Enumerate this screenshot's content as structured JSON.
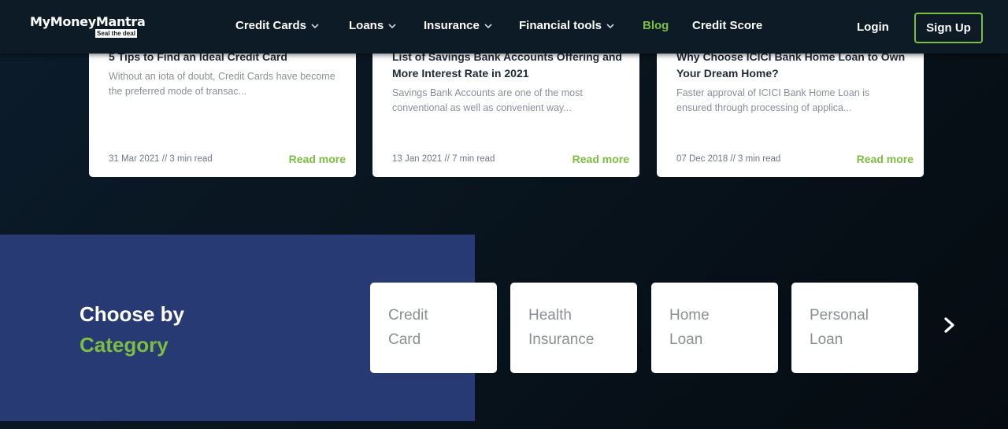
{
  "header": {
    "logo_main": "MyMoneyMantra",
    "logo_tagline": "Seal the deal",
    "nav": [
      {
        "label": "Credit Cards",
        "dropdown": true
      },
      {
        "label": "Loans",
        "dropdown": true
      },
      {
        "label": "Insurance",
        "dropdown": true
      },
      {
        "label": "Financial tools",
        "dropdown": true
      },
      {
        "label": "Blog",
        "dropdown": false,
        "active": true
      },
      {
        "label": "Credit Score",
        "dropdown": false
      }
    ],
    "login_label": "Login",
    "signup_label": "Sign Up"
  },
  "blog_cards": [
    {
      "title": "5 Tips to Find an Ideal Credit Card",
      "excerpt": "Without an iota of doubt, Credit Cards have become the preferred mode of transac...",
      "meta": "31 Mar 2021 // 3 min read",
      "read_more": "Read more"
    },
    {
      "title": "List of Savings Bank Accounts Offering and More Interest Rate in 2021",
      "excerpt": "Savings Bank Accounts are one of the most conventional as well as convenient way...",
      "meta": "13 Jan 2021 // 7 min read",
      "read_more": "Read more"
    },
    {
      "title": "Why Choose ICICI Bank Home Loan to Own Your Dream Home?",
      "excerpt": "Faster approval of ICICI Bank Home Loan is ensured through processing of applica...",
      "meta": "07 Dec 2018 // 3 min read",
      "read_more": "Read more"
    }
  ],
  "category": {
    "heading_line1": "Choose by",
    "heading_line2": "Category",
    "items": [
      {
        "label": "Credit\nCard"
      },
      {
        "label": "Health\nInsurance"
      },
      {
        "label": "Home\nLoan"
      },
      {
        "label": "Personal\nLoan"
      }
    ],
    "next_icon": "chevron-right-icon"
  },
  "colors": {
    "accent_green": "#7cbe42",
    "header_bg": "#0d1b27",
    "category_panel": "#283a73"
  }
}
